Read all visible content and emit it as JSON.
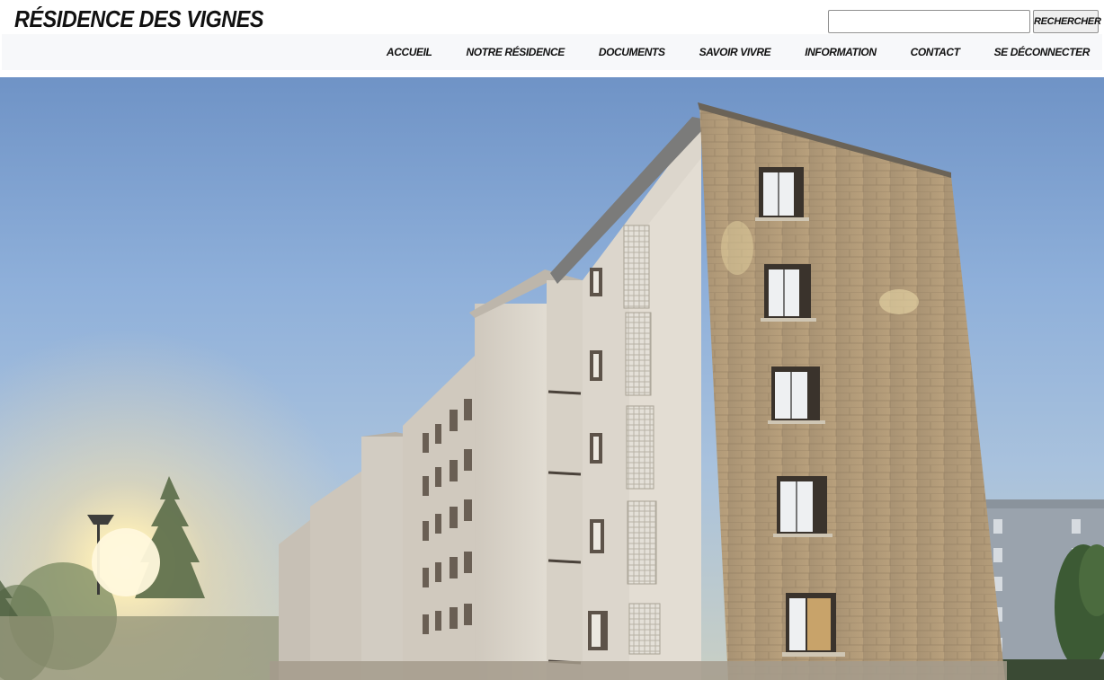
{
  "header": {
    "site_title": "Résidence des Vignes"
  },
  "search": {
    "placeholder": "",
    "value": "",
    "button_label": "RECHERCHER"
  },
  "nav": {
    "items": [
      {
        "label": "ACCUEIL"
      },
      {
        "label": "NOTRE RÉSIDENCE"
      },
      {
        "label": "DOCUMENTS"
      },
      {
        "label": "SAVOIR VIVRE"
      },
      {
        "label": "INFORMATION"
      },
      {
        "label": "CONTACT"
      },
      {
        "label": "SE DÉCONNECTER"
      }
    ]
  },
  "hero": {
    "image": "residential-building-photo",
    "colors": {
      "sky_top": "#6f93c6",
      "sky_bottom": "#a9c2dd",
      "sun": "#fff3c8",
      "brick": "#b59d7a",
      "render": "#d8d2c8"
    }
  }
}
